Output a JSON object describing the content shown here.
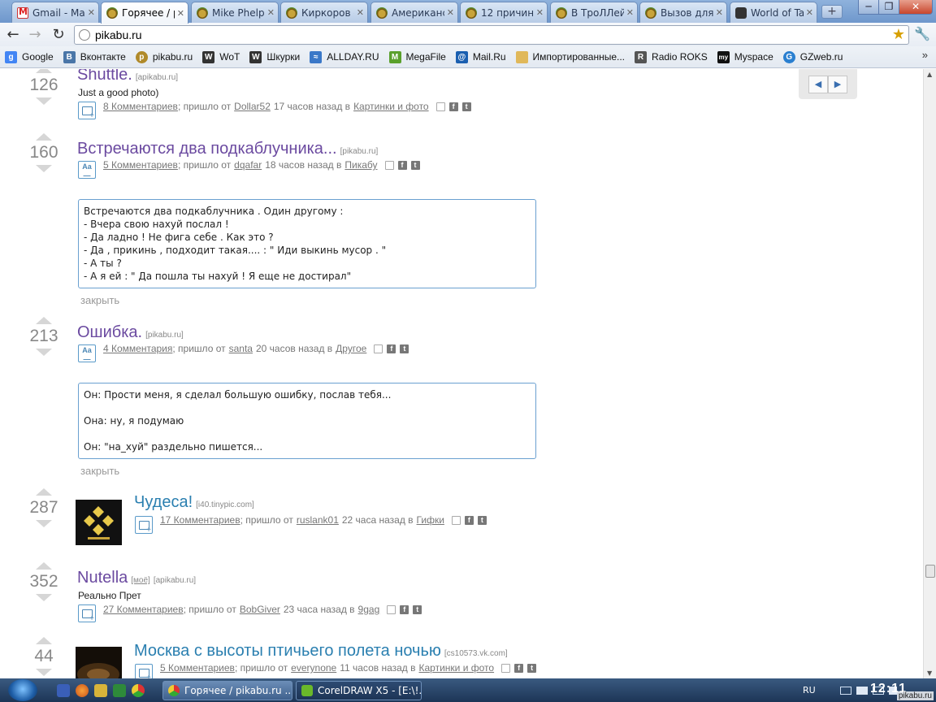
{
  "browser": {
    "tabs": [
      {
        "title": "Gmail - Ma",
        "icon": "gmail-icon",
        "active": false
      },
      {
        "title": "Горячее / р",
        "icon": "pikabu-icon",
        "active": true
      },
      {
        "title": "Mike Phelp",
        "icon": "pikabu-icon",
        "active": false
      },
      {
        "title": "Киркоров -",
        "icon": "pikabu-icon",
        "active": false
      },
      {
        "title": "Американс",
        "icon": "pikabu-icon",
        "active": false
      },
      {
        "title": "12 причин",
        "icon": "pikabu-icon",
        "active": false
      },
      {
        "title": "В ТроЛЛей",
        "icon": "pikabu-icon",
        "active": false
      },
      {
        "title": "Вызов для",
        "icon": "pikabu-icon",
        "active": false
      },
      {
        "title": "World of Ta",
        "icon": "wot-icon",
        "active": false
      }
    ],
    "tab_close": "✕",
    "new_tab": "+",
    "window_controls": {
      "minimize": "─",
      "maximize": "❐",
      "close": "✕"
    },
    "nav": {
      "back": "←",
      "forward": "→",
      "reload": "↻"
    },
    "url": "pikabu.ru",
    "star": "★",
    "wrench": "🔧"
  },
  "bookmarks": [
    {
      "label": "Google",
      "color": "#4285f4",
      "glyph": "g"
    },
    {
      "label": "Вконтакте",
      "color": "#4a76a8",
      "glyph": "B"
    },
    {
      "label": "pikabu.ru",
      "color": "#b08a2a",
      "glyph": "p"
    },
    {
      "label": "WoT",
      "color": "#333333",
      "glyph": "W"
    },
    {
      "label": "Шкурки",
      "color": "#333333",
      "glyph": "W"
    },
    {
      "label": "ALLDAY.RU",
      "color": "#3a78c8",
      "glyph": "≈"
    },
    {
      "label": "MegaFile",
      "color": "#5aa02c",
      "glyph": "M"
    },
    {
      "label": "Mail.Ru",
      "color": "#1b5fb0",
      "glyph": "@"
    },
    {
      "label": "Импортированные...",
      "color": "#e0b85a",
      "glyph": ""
    },
    {
      "label": "Radio ROKS",
      "color": "#555555",
      "glyph": "R"
    },
    {
      "label": "Myspace",
      "color": "#111111",
      "glyph": "my"
    },
    {
      "label": "GZweb.ru",
      "color": "#2a7fd0",
      "glyph": "G"
    }
  ],
  "bookmarks_more": "»",
  "posts": [
    {
      "score": "126",
      "title": "Shuttle.",
      "source": "[apikabu.ru]",
      "subtitle": "Just a good photo)",
      "comments": "8 Комментариев",
      "came_from": "; пришло от",
      "author": "Dollar52",
      "time": "17 часов назад в",
      "category": "Картинки и фото",
      "kind": "photo"
    },
    {
      "score": "160",
      "title": "Встречаются два подкаблучника...",
      "source": "[pikabu.ru]",
      "comments": "5 Комментариев",
      "came_from": "; пришло от",
      "author": "dqafar",
      "time": "18 часов назад в",
      "category": "Пикабу",
      "kind": "text",
      "text_lines": [
        "Встречаются два подкаблучника . Один другому :",
        "- Вчера свою нахуй послал !",
        "- Да ладно ! Не фига себе . Как это ?",
        "- Да , прикинь , подходит такая.... : \" Иди выкинь мусор . \"",
        "- А ты ?",
        "- А я ей : \" Да пошла ты нахуй ! Я еще не достирал\""
      ],
      "close": "закрыть"
    },
    {
      "score": "213",
      "title": "Ошибка.",
      "source": "[pikabu.ru]",
      "comments": "4 Комментария",
      "came_from": "; пришло от",
      "author": "santa",
      "time": "20 часов назад в",
      "category": "Другое",
      "kind": "text",
      "text_lines": [
        "Он: Прости меня, я сделал большую ошибку, послав тебя...",
        "",
        "Она: ну, я подумаю",
        "",
        "Он: \"на_хуй\" раздельно пишется..."
      ],
      "close": "закрыть"
    },
    {
      "score": "287",
      "title": "Чудеса!",
      "source": "[i40.tinypic.com]",
      "comments": "17 Комментариев",
      "came_from": "; пришло от",
      "author": "ruslank01",
      "time": "22 часа назад в",
      "category": "Гифки",
      "kind": "photo"
    },
    {
      "score": "352",
      "title": "Nutella",
      "source_mine": "[моё]",
      "source": "[apikabu.ru]",
      "subtitle": "Реально Прет",
      "comments": "27 Комментариев",
      "came_from": "; пришло от",
      "author": "BobGiver",
      "time": "23 часа назад в",
      "category": "9gag",
      "kind": "photo"
    },
    {
      "score": "44",
      "title": "Москва с высоты птичьего полета ночью",
      "source": "[cs10573.vk.com]",
      "comments": "5 Комментариев",
      "came_from": "; пришло от",
      "author": "everynone",
      "time": "11 часов назад в",
      "category": "Картинки и фото",
      "kind": "photo"
    }
  ],
  "pager": {
    "prev": "◀",
    "next": "▶"
  },
  "text_kind_glyph": "Aa",
  "share": {
    "fb": "f",
    "tw": "t"
  },
  "taskbar": {
    "tasks": [
      {
        "label": "Горячее / pikabu.ru ...",
        "active": true
      },
      {
        "label": "CorelDRAW X5 - [E:\\!...",
        "active": false
      }
    ],
    "lang": "RU",
    "clock": "12:11"
  },
  "watermark": "pikabu.ru"
}
